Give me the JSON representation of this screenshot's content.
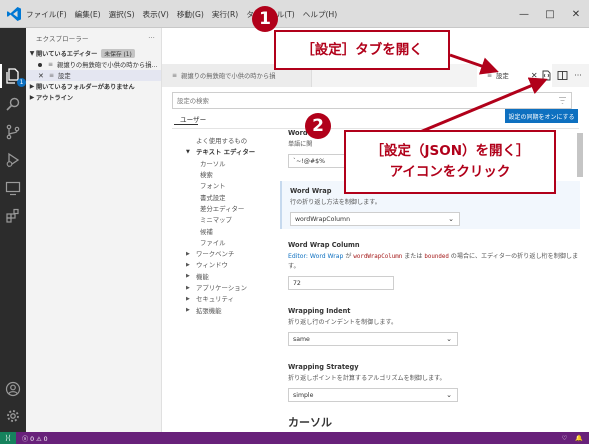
{
  "menu": [
    "ファイル(F)",
    "編集(E)",
    "選択(S)",
    "表示(V)",
    "移動(G)",
    "実行(R)",
    "ターミナル(T)",
    "ヘルプ(H)"
  ],
  "window_controls": {
    "minimize": "—",
    "maximize": "□",
    "close": "✕"
  },
  "activity_badge": "1",
  "sidebar": {
    "title": "エクスプローラー",
    "more": "···",
    "open_editors": {
      "label": "開いているエディター",
      "unsaved": "未保存 (1)"
    },
    "files": [
      {
        "name": "親譲りの無鉄砲で小供の時から損...",
        "icon": "file-icon"
      },
      {
        "name": "設定",
        "icon": "settings-file-icon"
      }
    ],
    "no_folder": "開いているフォルダーがありません",
    "outline": "アウトライン"
  },
  "tabs": {
    "tab1": "親譲りの無鉄砲で小供の時から損",
    "tab2": "設定",
    "tab2_close": "✕"
  },
  "settings": {
    "search_placeholder": "設定の検索",
    "scope_tab": "ユーザー",
    "sync_button": "設定の同期をオンにする",
    "toc": [
      {
        "label": "よく使用するもの",
        "level": "top-plain"
      },
      {
        "label": "テキスト エディター",
        "level": "expanded"
      },
      {
        "label": "カーソル",
        "level": "sub"
      },
      {
        "label": "検索",
        "level": "sub"
      },
      {
        "label": "フォント",
        "level": "sub"
      },
      {
        "label": "書式設定",
        "level": "sub"
      },
      {
        "label": "差分エディター",
        "level": "sub"
      },
      {
        "label": "ミニマップ",
        "level": "sub"
      },
      {
        "label": "候補",
        "level": "sub"
      },
      {
        "label": "ファイル",
        "level": "sub"
      },
      {
        "label": "ワークベンチ",
        "level": "collapsed"
      },
      {
        "label": "ウィンドウ",
        "level": "collapsed"
      },
      {
        "label": "機能",
        "level": "collapsed"
      },
      {
        "label": "アプリケーション",
        "level": "collapsed"
      },
      {
        "label": "セキュリティ",
        "level": "collapsed"
      },
      {
        "label": "拡張機能",
        "level": "collapsed"
      }
    ],
    "partial_top_title": "Word",
    "partial_top_desc": "単語に関",
    "partial_top_value": "`~!@#$%",
    "word_wrap": {
      "title": "Word Wrap",
      "description": "行の折り返し方法を制御します。",
      "value": "wordWrapColumn"
    },
    "word_wrap_column": {
      "title": "Word Wrap Column",
      "desc_link": "Editor: Word Wrap",
      "desc_1": " が ",
      "desc_code1": "wordWrapColumn",
      "desc_2": " または ",
      "desc_code2": "bounded",
      "desc_3": " の場合に、エディターの折り返し桁を制御します。",
      "value": "72"
    },
    "wrapping_indent": {
      "title": "Wrapping Indent",
      "description": "折り返し行のインデントを制御します。",
      "value": "same"
    },
    "wrapping_strategy": {
      "title": "Wrapping Strategy",
      "description": "折り返しポイントを計算するアルゴリズムを制御します。",
      "value": "simple"
    },
    "section_header": "カーソル"
  },
  "statusbar": {
    "remote": "⟩⟨",
    "errors": "0",
    "warnings": "0"
  },
  "callouts": {
    "c1_number": "1",
    "c1_text": "［設定］タブを開く",
    "c2_number": "2",
    "c2_line1": "［設定（JSON）を開く］",
    "c2_line2": "アイコンをクリック"
  },
  "colors": {
    "accent": "#0e70c0",
    "callout": "#b1001a",
    "statusbar": "#68217a",
    "activitybar": "#2c2c2c"
  }
}
